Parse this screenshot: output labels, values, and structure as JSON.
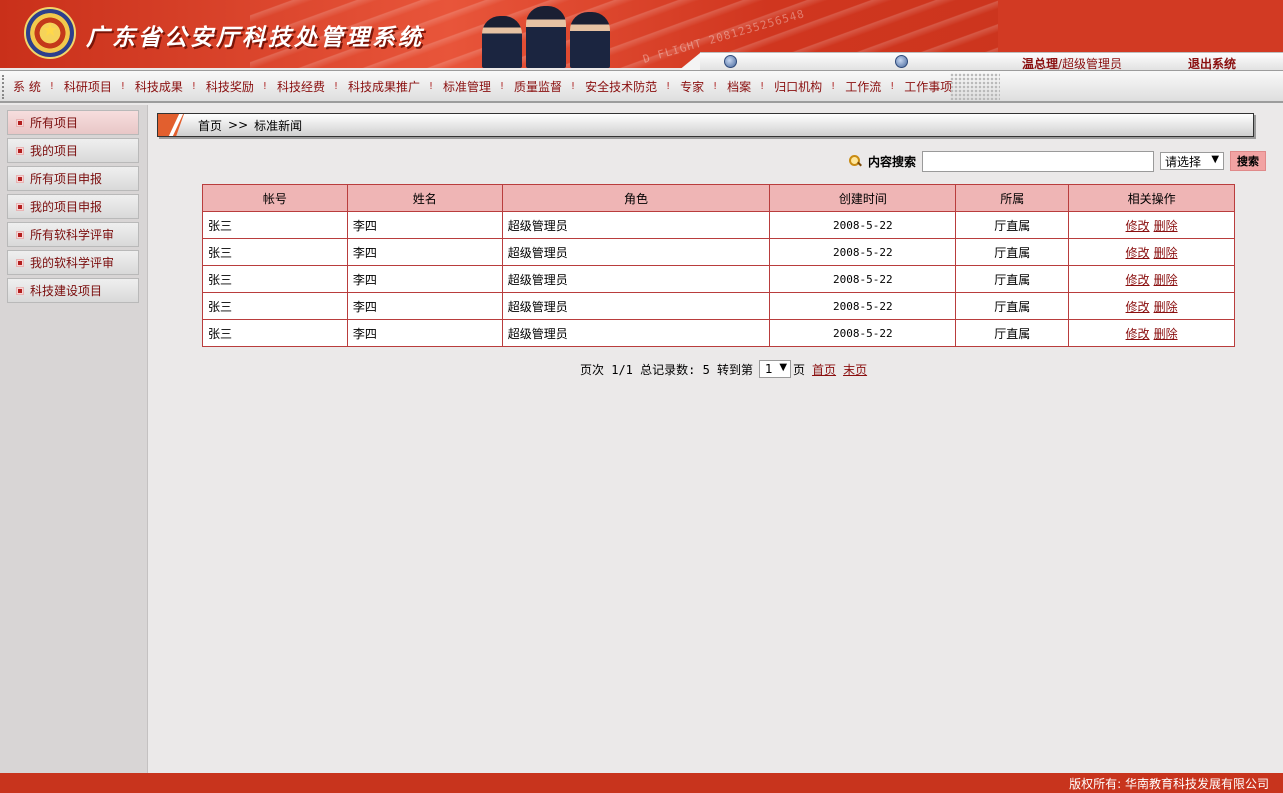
{
  "header": {
    "title": "广东省公安厅科技处管理系统",
    "flight_text": "D FLIGHT 2081235256548"
  },
  "status": {
    "user_name": "温总理",
    "user_role": "/超级管理员",
    "logout_label": "退出系统"
  },
  "nav": {
    "items": [
      "系 统",
      "科研项目",
      "科技成果",
      "科技奖励",
      "科技经费",
      "科技成果推广",
      "标准管理",
      "质量监督",
      "安全技术防范",
      "专家",
      "档案",
      "归口机构",
      "工作流",
      "工作事项"
    ],
    "separator": "!"
  },
  "sidebar": {
    "items": [
      "所有项目",
      "我的项目",
      "所有项目申报",
      "我的项目申报",
      "所有软科学评审",
      "我的软科学评审",
      "科技建设项目"
    ]
  },
  "breadcrumb": {
    "home": "首页",
    "separator": ">>",
    "current": "标准新闻"
  },
  "search": {
    "label": "内容搜索",
    "input_value": "",
    "select_value": "请选择",
    "button_label": "搜索"
  },
  "table": {
    "columns": [
      "帐号",
      "姓名",
      "角色",
      "创建时间",
      "所属",
      "相关操作"
    ],
    "rows": [
      {
        "account": "张三",
        "name": "李四",
        "role": "超级管理员",
        "created": "2008-5-22",
        "dept": "厅直属"
      },
      {
        "account": "张三",
        "name": "李四",
        "role": "超级管理员",
        "created": "2008-5-22",
        "dept": "厅直属"
      },
      {
        "account": "张三",
        "name": "李四",
        "role": "超级管理员",
        "created": "2008-5-22",
        "dept": "厅直属"
      },
      {
        "account": "张三",
        "name": "李四",
        "role": "超级管理员",
        "created": "2008-5-22",
        "dept": "厅直属"
      },
      {
        "account": "张三",
        "name": "李四",
        "role": "超级管理员",
        "created": "2008-5-22",
        "dept": "厅直属"
      }
    ],
    "edit_label": "修改",
    "delete_label": "删除"
  },
  "pager": {
    "page_info": "页次 1/1 总记录数: 5 转到第",
    "page_select_value": "1",
    "page_suffix": "页",
    "first_label": "首页",
    "last_label": "末页"
  },
  "footer": {
    "copyright": "版权所有: 华南教育科技发展有限公司"
  },
  "colors": {
    "brand_red": "#c8341d",
    "link_dark_red": "#8a0f0f",
    "table_header": "#efb5b5",
    "table_border": "#b93d3d"
  }
}
